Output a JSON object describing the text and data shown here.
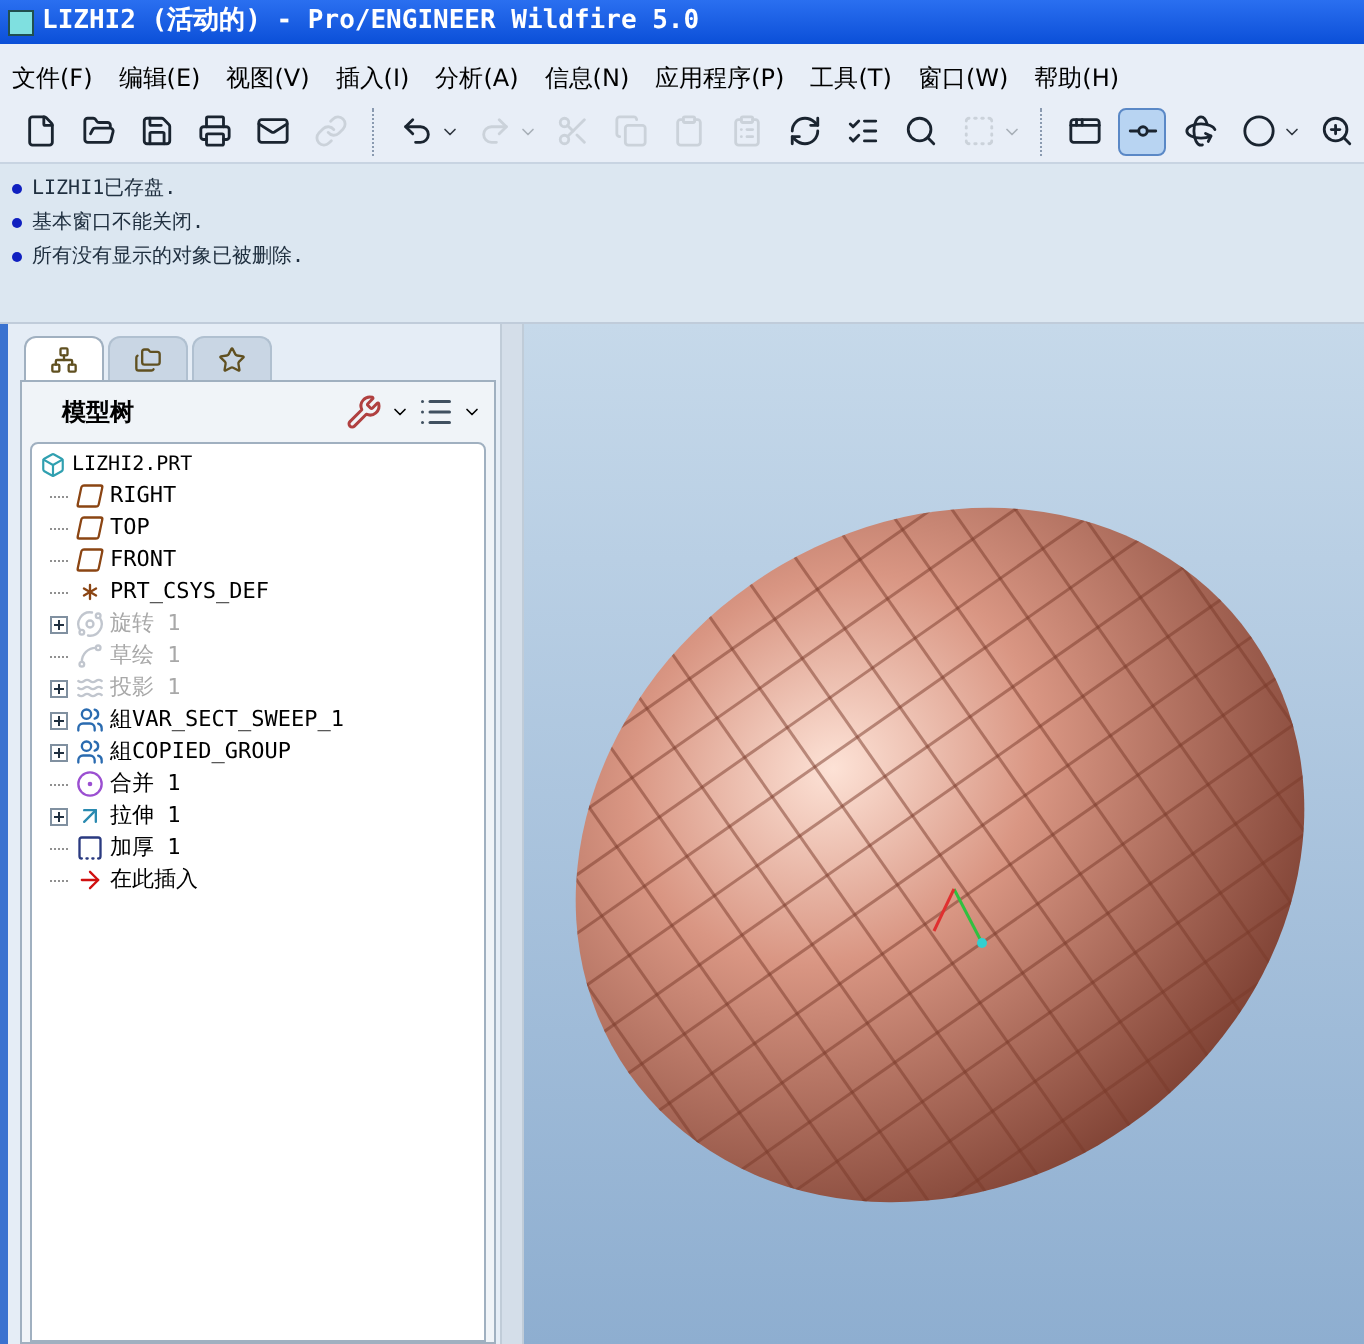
{
  "window": {
    "title": "LIZHI2 (活动的) - Pro/ENGINEER Wildfire 5.0"
  },
  "menu": [
    "文件(F)",
    "编辑(E)",
    "视图(V)",
    "插入(I)",
    "分析(A)",
    "信息(N)",
    "应用程序(P)",
    "工具(T)",
    "窗口(W)",
    "帮助(H)"
  ],
  "toolbar": [
    {
      "kind": "new",
      "disabled": false,
      "selected": false,
      "dropdown": false
    },
    {
      "kind": "open",
      "disabled": false,
      "selected": false,
      "dropdown": false
    },
    {
      "kind": "save",
      "disabled": false,
      "selected": false,
      "dropdown": false
    },
    {
      "kind": "print",
      "disabled": false,
      "selected": false,
      "dropdown": false
    },
    {
      "kind": "mail",
      "disabled": false,
      "selected": false,
      "dropdown": false
    },
    {
      "kind": "link",
      "disabled": true,
      "selected": false,
      "dropdown": false
    },
    {
      "kind": "separator"
    },
    {
      "kind": "undo",
      "disabled": false,
      "selected": false,
      "dropdown": true
    },
    {
      "kind": "redo",
      "disabled": true,
      "selected": false,
      "dropdown": true
    },
    {
      "kind": "cut",
      "disabled": true,
      "selected": false,
      "dropdown": false
    },
    {
      "kind": "copy",
      "disabled": true,
      "selected": false,
      "dropdown": false
    },
    {
      "kind": "paste",
      "disabled": true,
      "selected": false,
      "dropdown": false
    },
    {
      "kind": "paste-special",
      "disabled": true,
      "selected": false,
      "dropdown": false
    },
    {
      "kind": "regenerate",
      "disabled": false,
      "selected": false,
      "dropdown": false
    },
    {
      "kind": "regenerate-manager",
      "disabled": false,
      "selected": false,
      "dropdown": false
    },
    {
      "kind": "find",
      "disabled": false,
      "selected": false,
      "dropdown": false
    },
    {
      "kind": "select-box",
      "disabled": true,
      "selected": false,
      "dropdown": true
    },
    {
      "kind": "separator"
    },
    {
      "kind": "named-view",
      "disabled": false,
      "selected": false,
      "dropdown": false
    },
    {
      "kind": "datum-display",
      "disabled": false,
      "selected": true,
      "dropdown": false
    },
    {
      "kind": "spin-center",
      "disabled": false,
      "selected": false,
      "dropdown": false
    },
    {
      "kind": "shade",
      "disabled": false,
      "selected": false,
      "dropdown": true
    },
    {
      "kind": "zoom",
      "disabled": false,
      "selected": false,
      "dropdown": false
    }
  ],
  "messages": [
    "LIZHI1已存盘.",
    "基本窗口不能关闭.",
    "所有没有显示的对象已被删除."
  ],
  "navigator": {
    "tabs": [
      {
        "kind": "model-tree",
        "selected": true
      },
      {
        "kind": "folders",
        "selected": false
      },
      {
        "kind": "favorites",
        "selected": false
      }
    ],
    "title": "模型树",
    "tree": {
      "label": "LIZHI2.PRT",
      "kind": "part",
      "children": [
        {
          "label": "RIGHT",
          "kind": "plane",
          "disabled": false,
          "expandable": false
        },
        {
          "label": "TOP",
          "kind": "plane",
          "disabled": false,
          "expandable": false
        },
        {
          "label": "FRONT",
          "kind": "plane",
          "disabled": false,
          "expandable": false
        },
        {
          "label": "PRT_CSYS_DEF",
          "kind": "csys",
          "disabled": false,
          "expandable": false
        },
        {
          "label": "旋转 1",
          "kind": "revolve",
          "disabled": true,
          "expandable": true
        },
        {
          "label": "草绘 1",
          "kind": "sketch",
          "disabled": true,
          "expandable": false
        },
        {
          "label": "投影 1",
          "kind": "projection",
          "disabled": true,
          "expandable": true
        },
        {
          "label": "組VAR_SECT_SWEEP_1",
          "kind": "group",
          "disabled": false,
          "expandable": true
        },
        {
          "label": "組COPIED_GROUP",
          "kind": "group",
          "disabled": false,
          "expandable": true
        },
        {
          "label": "合并 1",
          "kind": "merge",
          "disabled": false,
          "expandable": false
        },
        {
          "label": "拉伸 1",
          "kind": "extrude",
          "disabled": false,
          "expandable": true
        },
        {
          "label": "加厚 1",
          "kind": "thicken",
          "disabled": false,
          "expandable": false
        },
        {
          "label": "在此插入",
          "kind": "insert-here",
          "disabled": false,
          "expandable": false
        }
      ]
    }
  }
}
